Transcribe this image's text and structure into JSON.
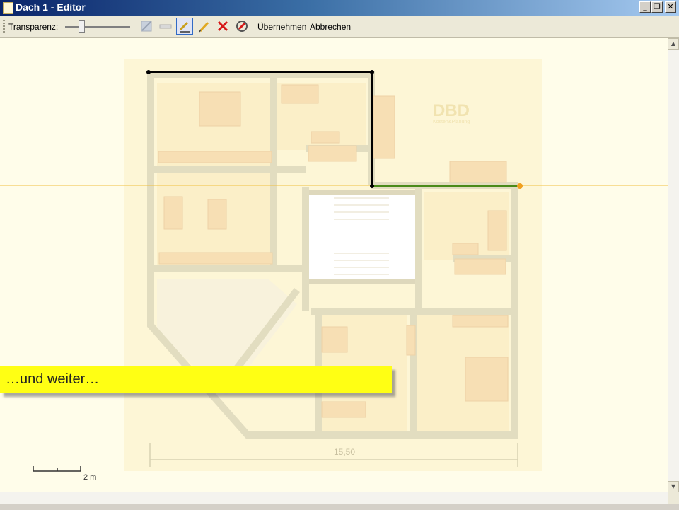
{
  "window": {
    "title": "Dach 1 - Editor",
    "controls": [
      "minimize",
      "restore",
      "close"
    ]
  },
  "toolbar": {
    "transparency_label": "Transparenz:",
    "transparency_value": 0.3,
    "tools": [
      {
        "name": "wall-tool-icon",
        "enabled": false
      },
      {
        "name": "measure-tool-icon",
        "enabled": false
      },
      {
        "name": "draw-line-tool-icon",
        "enabled": true,
        "active": true
      },
      {
        "name": "pencil-icon",
        "enabled": true
      },
      {
        "name": "delete-x-icon",
        "enabled": true
      },
      {
        "name": "roof-tool-icon",
        "enabled": true
      }
    ],
    "apply_label": "Übernehmen",
    "cancel_label": "Abbrechen"
  },
  "canvas": {
    "plan_dimension_label": "15,50",
    "scale_label": "2 m",
    "logo_text": "DBD",
    "logo_subtext": "Kosten&Planung",
    "callout_text": "…und weiter…"
  },
  "colors": {
    "canvas_bg": "#fffdea",
    "plan_walls": "#e2ddc0",
    "drawn_line": "#000000",
    "current_segment": "#4a8a1a",
    "guide_line": "#f0c040",
    "callout_bg": "#ffff14"
  }
}
